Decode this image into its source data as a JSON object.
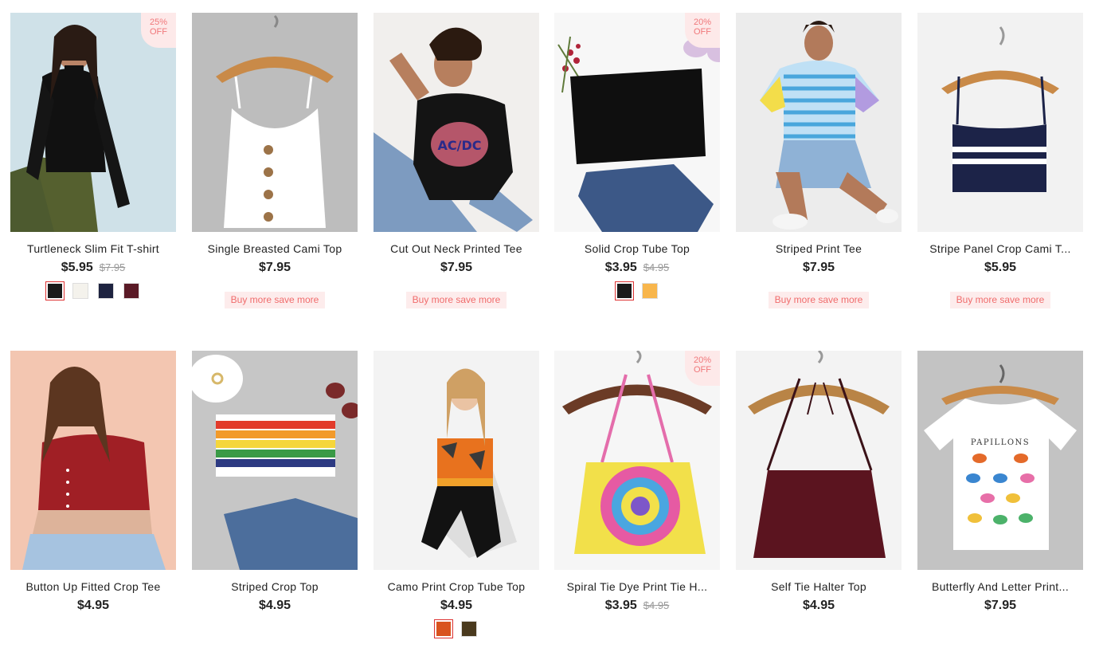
{
  "products": [
    {
      "title": "Turtleneck Slim Fit T-shirt",
      "price": "$5.95",
      "old_price": "$7.95",
      "badge": [
        "25%",
        "OFF"
      ],
      "swatches": [
        "#1a1a1a",
        "#f4f2ec",
        "#1e2340",
        "#5a1a26"
      ]
    },
    {
      "title": "Single Breasted Cami Top",
      "price": "$7.95",
      "promo": "Buy more save more"
    },
    {
      "title": "Cut Out Neck Printed Tee",
      "price": "$7.95",
      "promo": "Buy more save more"
    },
    {
      "title": "Solid Crop Tube Top",
      "price": "$3.95",
      "old_price": "$4.95",
      "badge": [
        "20%",
        "OFF"
      ],
      "swatches": [
        "#1a1a1a",
        "#f8b64c"
      ]
    },
    {
      "title": "Striped Print Tee",
      "price": "$7.95",
      "promo": "Buy more save more"
    },
    {
      "title": "Stripe Panel Crop Cami T...",
      "price": "$5.95",
      "promo": "Buy more save more"
    },
    {
      "title": "Button Up Fitted Crop Tee",
      "price": "$4.95"
    },
    {
      "title": "Striped Crop Top",
      "price": "$4.95"
    },
    {
      "title": "Camo Print Crop Tube Top",
      "price": "$4.95",
      "swatches": [
        "#d9531e",
        "#4a3a1e"
      ]
    },
    {
      "title": "Spiral Tie Dye Print Tie H...",
      "price": "$3.95",
      "old_price": "$4.95",
      "badge": [
        "20%",
        "OFF"
      ]
    },
    {
      "title": "Self Tie Halter Top",
      "price": "$4.95"
    },
    {
      "title": "Butterfly And Letter Print...",
      "price": "$7.95",
      "print_text": "PAPILLONS"
    }
  ]
}
